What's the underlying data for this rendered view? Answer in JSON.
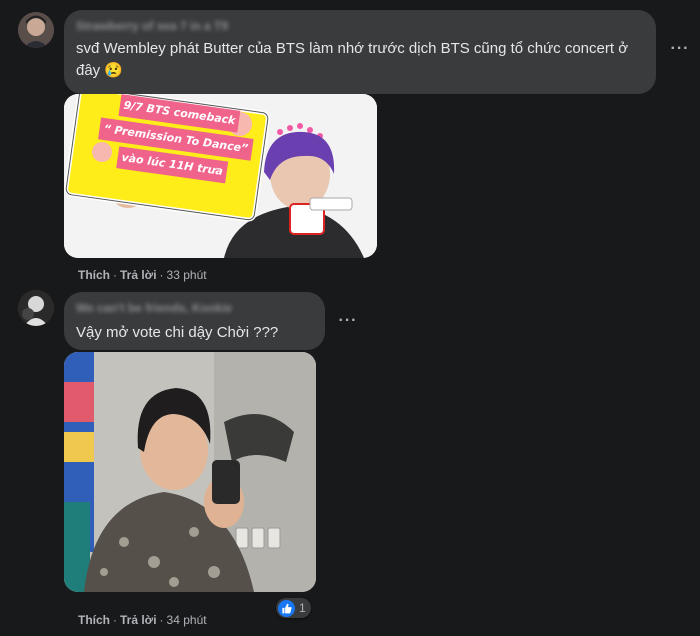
{
  "comments": [
    {
      "author": "Strawberry of sea 7 in a T9",
      "text": "svđ Wembley phát Butter của BTS làm nhớ trước dịch BTS cũng tổ chức concert ở đây 😢",
      "image": {
        "sign_lines": [
          "9/7 BTS comeback",
          "“ Premission To Dance”",
          "vào lúc 11H trưa"
        ]
      },
      "actions": {
        "like": "Thích",
        "reply": "Trả lời",
        "time": "33 phút"
      }
    },
    {
      "author": "We can't be friends, Kookie",
      "text": "Vậy mở vote chi dậy Chời ???",
      "actions": {
        "like": "Thích",
        "reply": "Trả lời",
        "time": "34 phút"
      },
      "reaction": {
        "icon": "like-icon",
        "count": "1"
      }
    }
  ],
  "colors": {
    "background": "#18191a",
    "bubble": "#3a3b3c",
    "text": "#e4e6eb",
    "muted": "#b0b3b8",
    "like_blue": "#1877f2",
    "sign_yellow": "#ffed1a"
  }
}
